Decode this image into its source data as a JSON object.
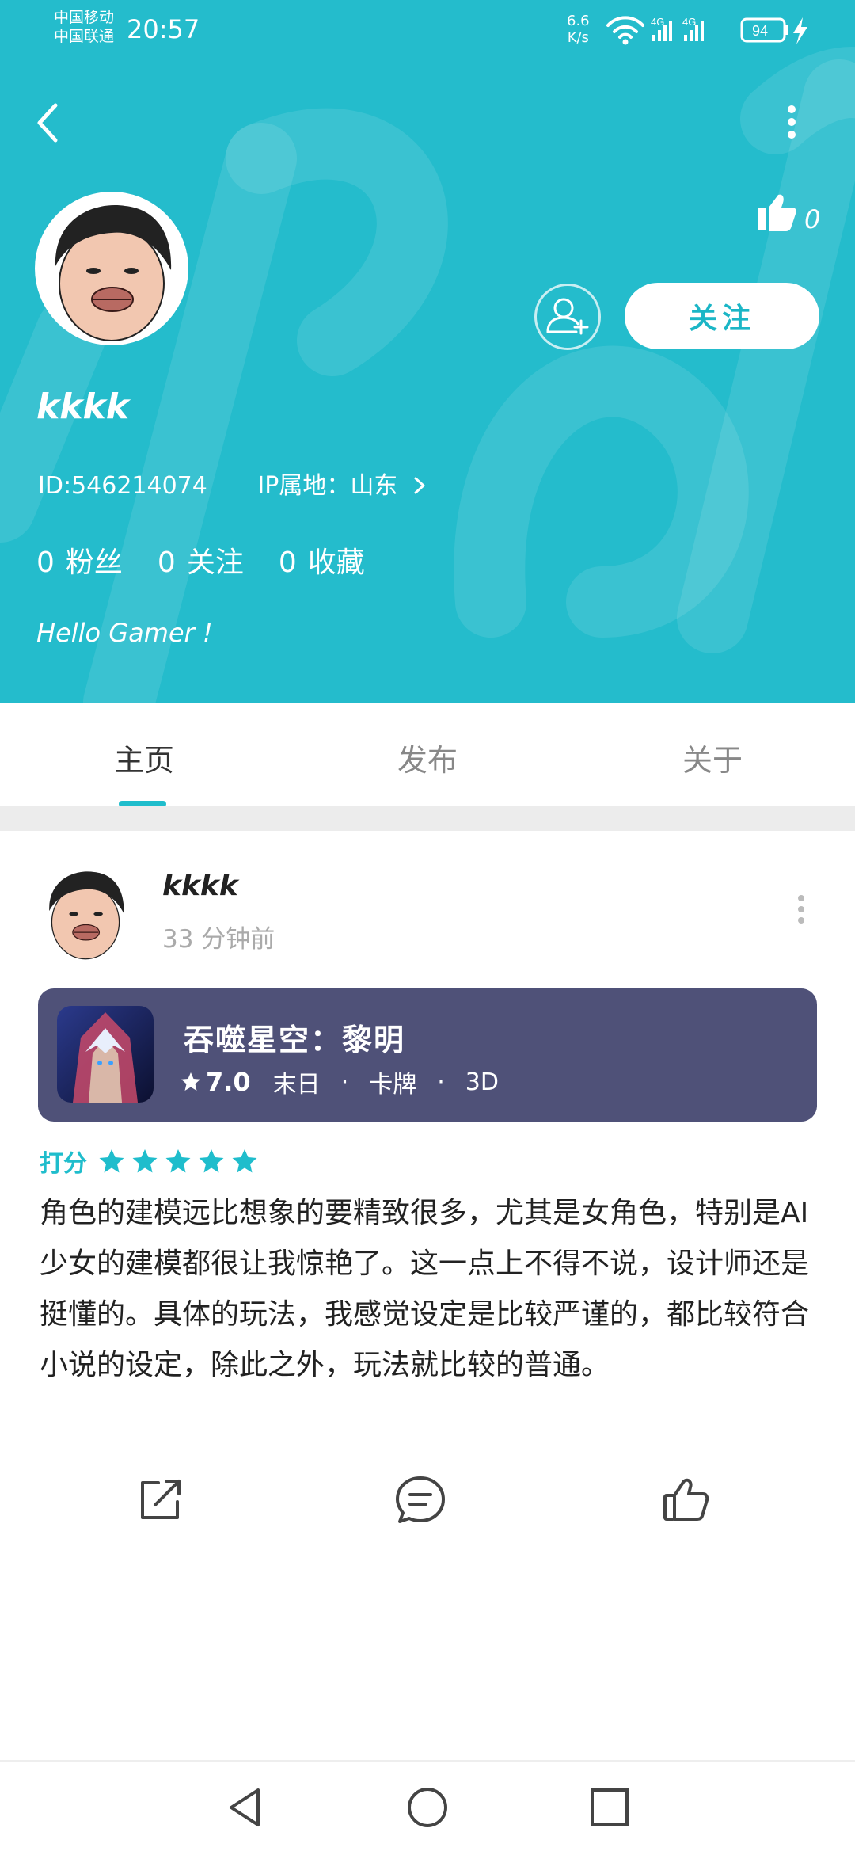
{
  "status_bar": {
    "carrier_1": "中国移动",
    "carrier_2": "中国联通",
    "time": "20:57",
    "net_speed_value": "6.6",
    "net_speed_unit": "K/s",
    "signal_1": "4G",
    "signal_2": "4G",
    "battery": "94"
  },
  "profile": {
    "username": "kkkk",
    "id_label": "ID:546214074",
    "ip_label": "IP属地：山东",
    "likes": "0",
    "follow_button": "关注",
    "stats": [
      {
        "count": "0",
        "label": "粉丝"
      },
      {
        "count": "0",
        "label": "关注"
      },
      {
        "count": "0",
        "label": "收藏"
      }
    ],
    "bio": "Hello Gamer !"
  },
  "tabs": [
    {
      "label": "主页",
      "active": true
    },
    {
      "label": "发布",
      "active": false
    },
    {
      "label": "关于",
      "active": false
    }
  ],
  "post": {
    "author": "kkkk",
    "time": "33 分钟前",
    "game": {
      "title": "吞噬星空：黎明",
      "score": "7.0",
      "tags": [
        "末日",
        "卡牌",
        "3D"
      ],
      "card_color": "#4f5178"
    },
    "rating_label": "打分",
    "rating_stars": 5,
    "review": "角色的建模远比想象的要精致很多，尤其是女角色，特别是AI少女的建模都很让我惊艳了。这一点上不得不说，设计师还是挺懂的。具体的玩法，我感觉设定是比较严谨的，都比较符合小说的设定，除此之外，玩法就比较的普通。"
  },
  "icons": {
    "back": "back-arrow-icon",
    "more": "more-vertical-icon",
    "like": "thumbs-up-icon",
    "add_friend": "add-user-icon",
    "share": "share-icon",
    "comment": "comment-icon",
    "nav_back": "nav-back-icon",
    "nav_home": "nav-home-icon",
    "nav_recents": "nav-recents-icon"
  },
  "colors": {
    "brand": "#24bccc",
    "accent": "#1fbdcc",
    "card": "#4f5178"
  }
}
